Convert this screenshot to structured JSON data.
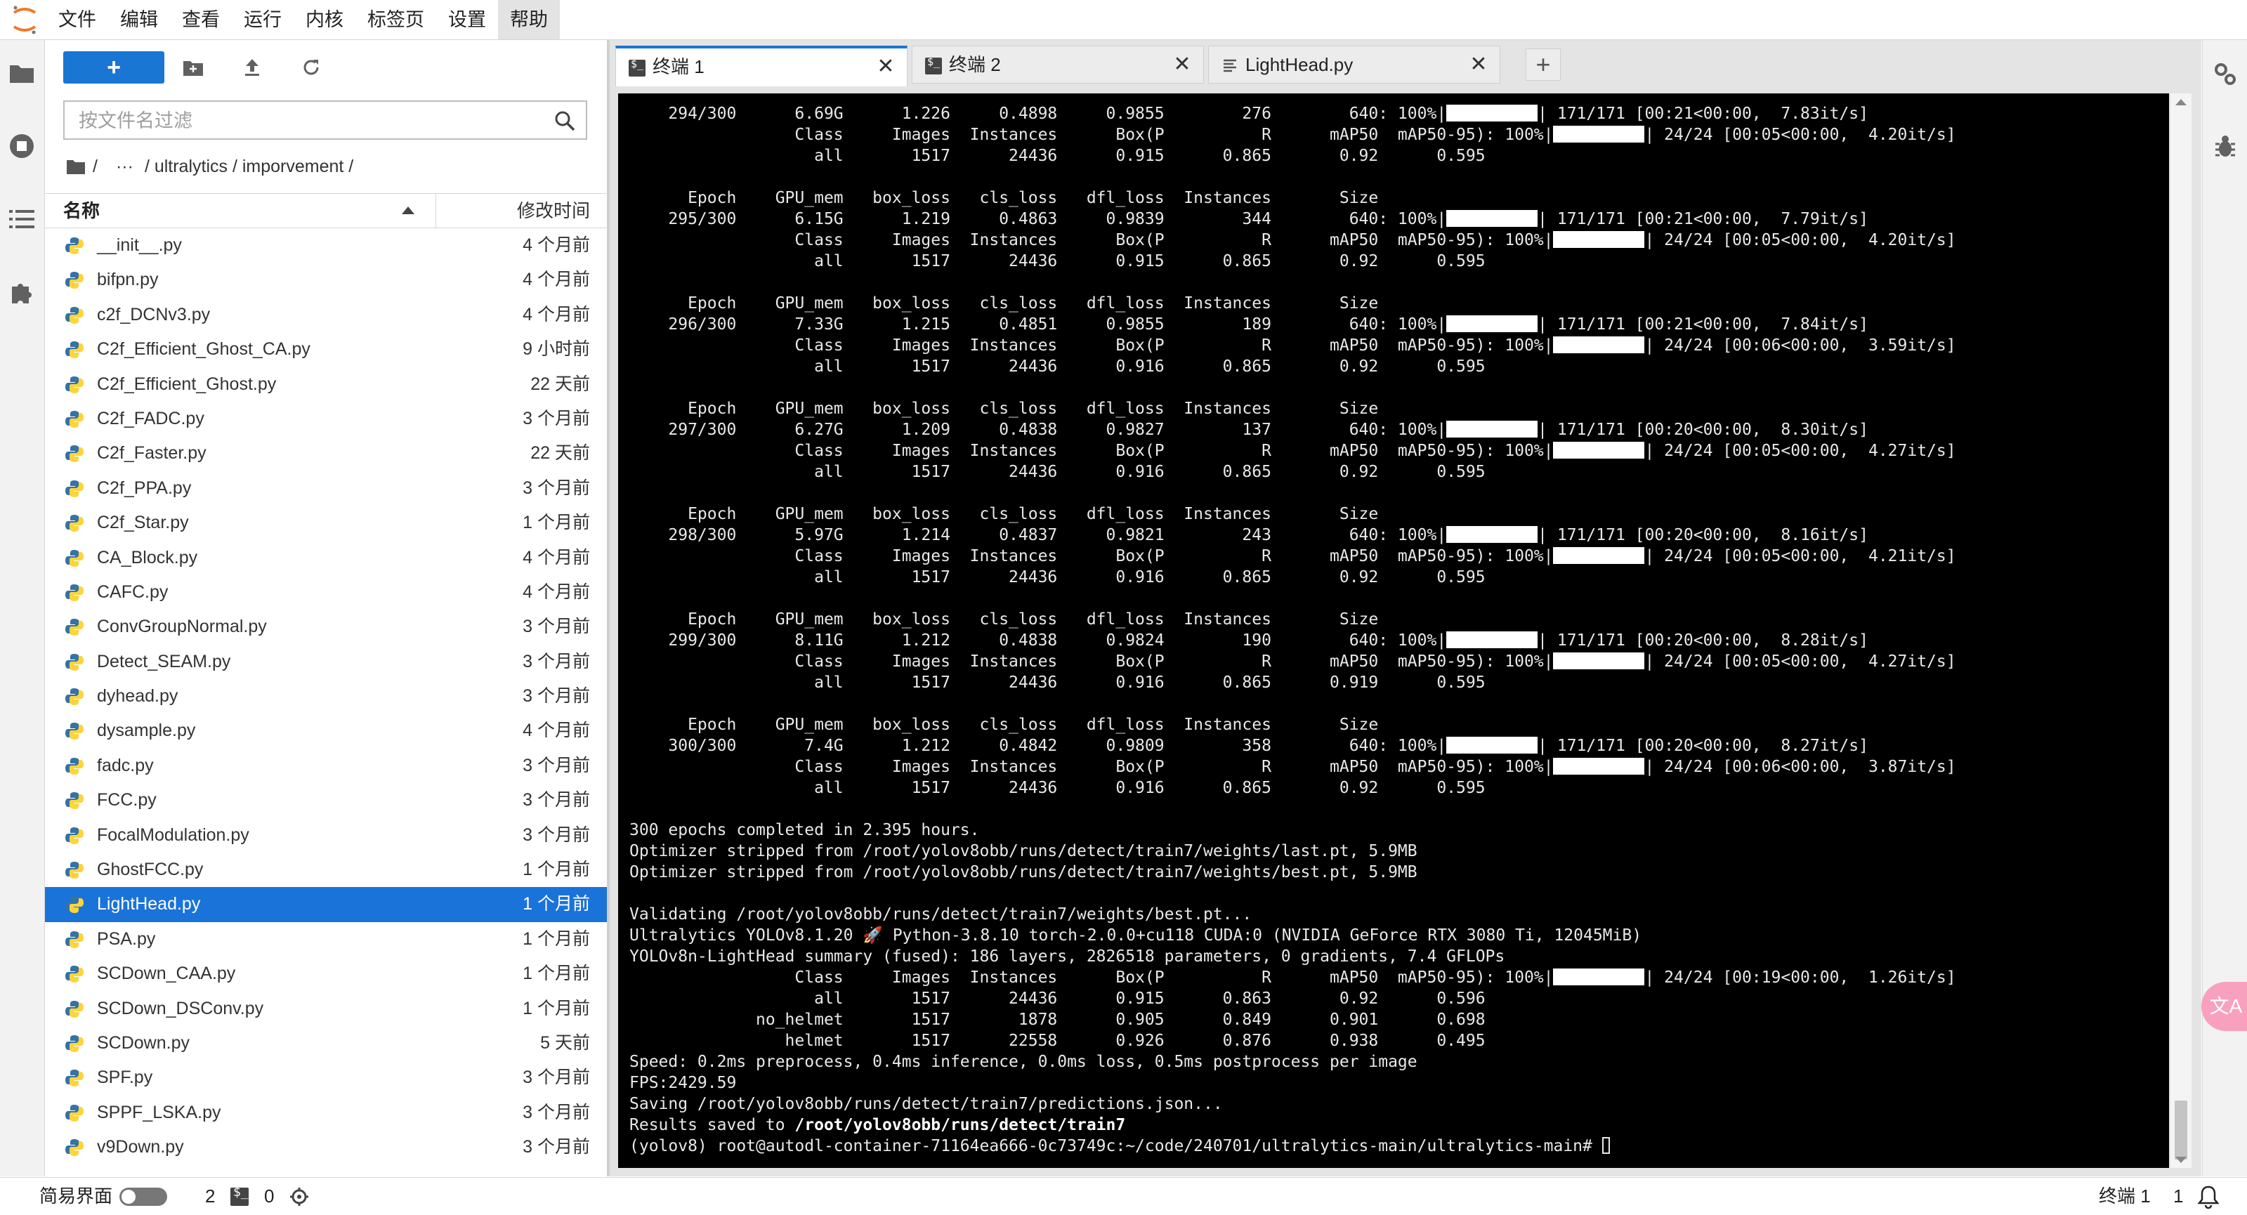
{
  "menu": {
    "items": [
      "文件",
      "编辑",
      "查看",
      "运行",
      "内核",
      "标签页",
      "设置",
      "帮助"
    ],
    "active_index": 7
  },
  "icons": {
    "logo": "jupyter-logo-icon",
    "left_strip": [
      "folder-icon",
      "running-stop-icon",
      "table-of-contents-icon",
      "extension-puzzle-icon"
    ],
    "right_strip": [
      "property-inspector-gears-icon",
      "debugger-bug-icon"
    ]
  },
  "filebrowser": {
    "new_button_label": "+",
    "search_placeholder": "按文件名过滤",
    "breadcrumbs": [
      "/",
      "···",
      "/ ultralytics / imporvement /"
    ],
    "col_name": "名称",
    "col_modified": "修改时间",
    "files": [
      {
        "name": "__init__.py",
        "modified": "4 个月前"
      },
      {
        "name": "bifpn.py",
        "modified": "4 个月前"
      },
      {
        "name": "c2f_DCNv3.py",
        "modified": "4 个月前"
      },
      {
        "name": "C2f_Efficient_Ghost_CA.py",
        "modified": "9 小时前"
      },
      {
        "name": "C2f_Efficient_Ghost.py",
        "modified": "22 天前"
      },
      {
        "name": "C2f_FADC.py",
        "modified": "3 个月前"
      },
      {
        "name": "C2f_Faster.py",
        "modified": "22 天前"
      },
      {
        "name": "C2f_PPA.py",
        "modified": "3 个月前"
      },
      {
        "name": "C2f_Star.py",
        "modified": "1 个月前"
      },
      {
        "name": "CA_Block.py",
        "modified": "4 个月前"
      },
      {
        "name": "CAFC.py",
        "modified": "4 个月前"
      },
      {
        "name": "ConvGroupNormal.py",
        "modified": "3 个月前"
      },
      {
        "name": "Detect_SEAM.py",
        "modified": "3 个月前"
      },
      {
        "name": "dyhead.py",
        "modified": "3 个月前"
      },
      {
        "name": "dysample.py",
        "modified": "4 个月前"
      },
      {
        "name": "fadc.py",
        "modified": "3 个月前"
      },
      {
        "name": "FCC.py",
        "modified": "3 个月前"
      },
      {
        "name": "FocalModulation.py",
        "modified": "3 个月前"
      },
      {
        "name": "GhostFCC.py",
        "modified": "1 个月前"
      },
      {
        "name": "LightHead.py",
        "modified": "1 个月前"
      },
      {
        "name": "PSA.py",
        "modified": "1 个月前"
      },
      {
        "name": "SCDown_CAA.py",
        "modified": "1 个月前"
      },
      {
        "name": "SCDown_DSConv.py",
        "modified": "1 个月前"
      },
      {
        "name": "SCDown.py",
        "modified": "5 天前"
      },
      {
        "name": "SPF.py",
        "modified": "3 个月前"
      },
      {
        "name": "SPPF_LSKA.py",
        "modified": "3 个月前"
      },
      {
        "name": "v9Down.py",
        "modified": "3 个月前"
      }
    ],
    "selected_index": 19
  },
  "tabs": {
    "items": [
      {
        "label": "终端 1",
        "icon": "terminal-icon",
        "active": true
      },
      {
        "label": "终端 2",
        "icon": "terminal-icon",
        "active": false
      },
      {
        "label": "LightHead.py",
        "icon": "text-file-icon",
        "active": false
      }
    ],
    "close_glyph": "✕",
    "add_glyph": "+"
  },
  "terminal": {
    "epoch_block": {
      "train_header": "      Epoch    GPU_mem   box_loss   cls_loss   dfl_loss  Instances       Size",
      "val_header": "                 Class     Images  Instances      Box(P          R      mAP50  mAP50-95): 100%|",
      "val_all_prefix": "                   all       1517      24436"
    },
    "first_partial": {
      "epoch_line": "    294/300      6.69G      1.226     0.4898     0.9855        276        640: 100%|",
      "train_tail": "| 171/171 [00:21<00:00,  7.83it/s]",
      "val_tail": "| 24/24 [00:05<00:00,  4.20it/s]",
      "val_metrics": "      0.915      0.865       0.92      0.595"
    },
    "epochs": [
      {
        "epoch": "295/300",
        "gpu": "6.15G",
        "box": "1.219",
        "cls": "0.4863",
        "dfl": "0.9839",
        "inst": "344",
        "train_time": "[00:21<00:00,  7.79it/s]",
        "val_time": "[00:05<00:00,  4.20it/s]",
        "P": "0.915",
        "R": "0.865",
        "mAP50": "0.92",
        "mAP5095": "0.595"
      },
      {
        "epoch": "296/300",
        "gpu": "7.33G",
        "box": "1.215",
        "cls": "0.4851",
        "dfl": "0.9855",
        "inst": "189",
        "train_time": "[00:21<00:00,  7.84it/s]",
        "val_time": "[00:06<00:00,  3.59it/s]",
        "P": "0.916",
        "R": "0.865",
        "mAP50": "0.92",
        "mAP5095": "0.595"
      },
      {
        "epoch": "297/300",
        "gpu": "6.27G",
        "box": "1.209",
        "cls": "0.4838",
        "dfl": "0.9827",
        "inst": "137",
        "train_time": "[00:20<00:00,  8.30it/s]",
        "val_time": "[00:05<00:00,  4.27it/s]",
        "P": "0.916",
        "R": "0.865",
        "mAP50": "0.92",
        "mAP5095": "0.595"
      },
      {
        "epoch": "298/300",
        "gpu": "5.97G",
        "box": "1.214",
        "cls": "0.4837",
        "dfl": "0.9821",
        "inst": "243",
        "train_time": "[00:20<00:00,  8.16it/s]",
        "val_time": "[00:05<00:00,  4.21it/s]",
        "P": "0.916",
        "R": "0.865",
        "mAP50": "0.92",
        "mAP5095": "0.595"
      },
      {
        "epoch": "299/300",
        "gpu": "8.11G",
        "box": "1.212",
        "cls": "0.4838",
        "dfl": "0.9824",
        "inst": "190",
        "train_time": "[00:20<00:00,  8.28it/s]",
        "val_time": "[00:05<00:00,  4.27it/s]",
        "P": "0.916",
        "R": "0.865",
        "mAP50": "0.919",
        "mAP5095": "0.595"
      },
      {
        "epoch": "300/300",
        "gpu": "7.4G",
        "box": "1.212",
        "cls": "0.4842",
        "dfl": "0.9809",
        "inst": "358",
        "train_time": "[00:20<00:00,  8.27it/s]",
        "val_time": "[00:06<00:00,  3.87it/s]",
        "P": "0.916",
        "R": "0.865",
        "mAP50": "0.92",
        "mAP5095": "0.595"
      }
    ],
    "summary_lines": [
      "300 epochs completed in 2.395 hours.",
      "Optimizer stripped from /root/yolov8obb/runs/detect/train7/weights/last.pt, 5.9MB",
      "Optimizer stripped from /root/yolov8obb/runs/detect/train7/weights/best.pt, 5.9MB",
      "",
      "Validating /root/yolov8obb/runs/detect/train7/weights/best.pt...",
      "Ultralytics YOLOv8.1.20 🚀 Python-3.8.10 torch-2.0.0+cu118 CUDA:0 (NVIDIA GeForce RTX 3080 Ti, 12045MiB)",
      "YOLOv8n-LightHead summary (fused): 186 layers, 2826518 parameters, 0 gradients, 7.4 GFLOPs"
    ],
    "final_val": {
      "header": "                 Class     Images  Instances      Box(P          R      mAP50  mAP50-95): 100%|",
      "header_tail": "| 24/24 [00:19<00:00,  1.26it/s]",
      "rows": [
        "                   all       1517      24436      0.915      0.863       0.92      0.596",
        "             no_helmet       1517       1878      0.905      0.849      0.901      0.698",
        "                helmet       1517      22558      0.926      0.876      0.938      0.495"
      ]
    },
    "tail_lines": [
      "Speed: 0.2ms preprocess, 0.4ms inference, 0.0ms loss, 0.5ms postprocess per image",
      "FPS:2429.59",
      "Saving /root/yolov8obb/runs/detect/train7/predictions.json..."
    ],
    "results_prefix": "Results saved to ",
    "results_path": "/root/yolov8obb/runs/detect/train7",
    "prompt": "(yolov8) root@autodl-container-71164ea666-0c73749c:~/code/240701/ultralytics-main/ultralytics-main# "
  },
  "translate_button": "文A",
  "statusbar": {
    "simple_mode": "简易界面",
    "terminals_count": "2",
    "kernels_count": "0",
    "right_label": "终端 1",
    "right_count": "1"
  }
}
